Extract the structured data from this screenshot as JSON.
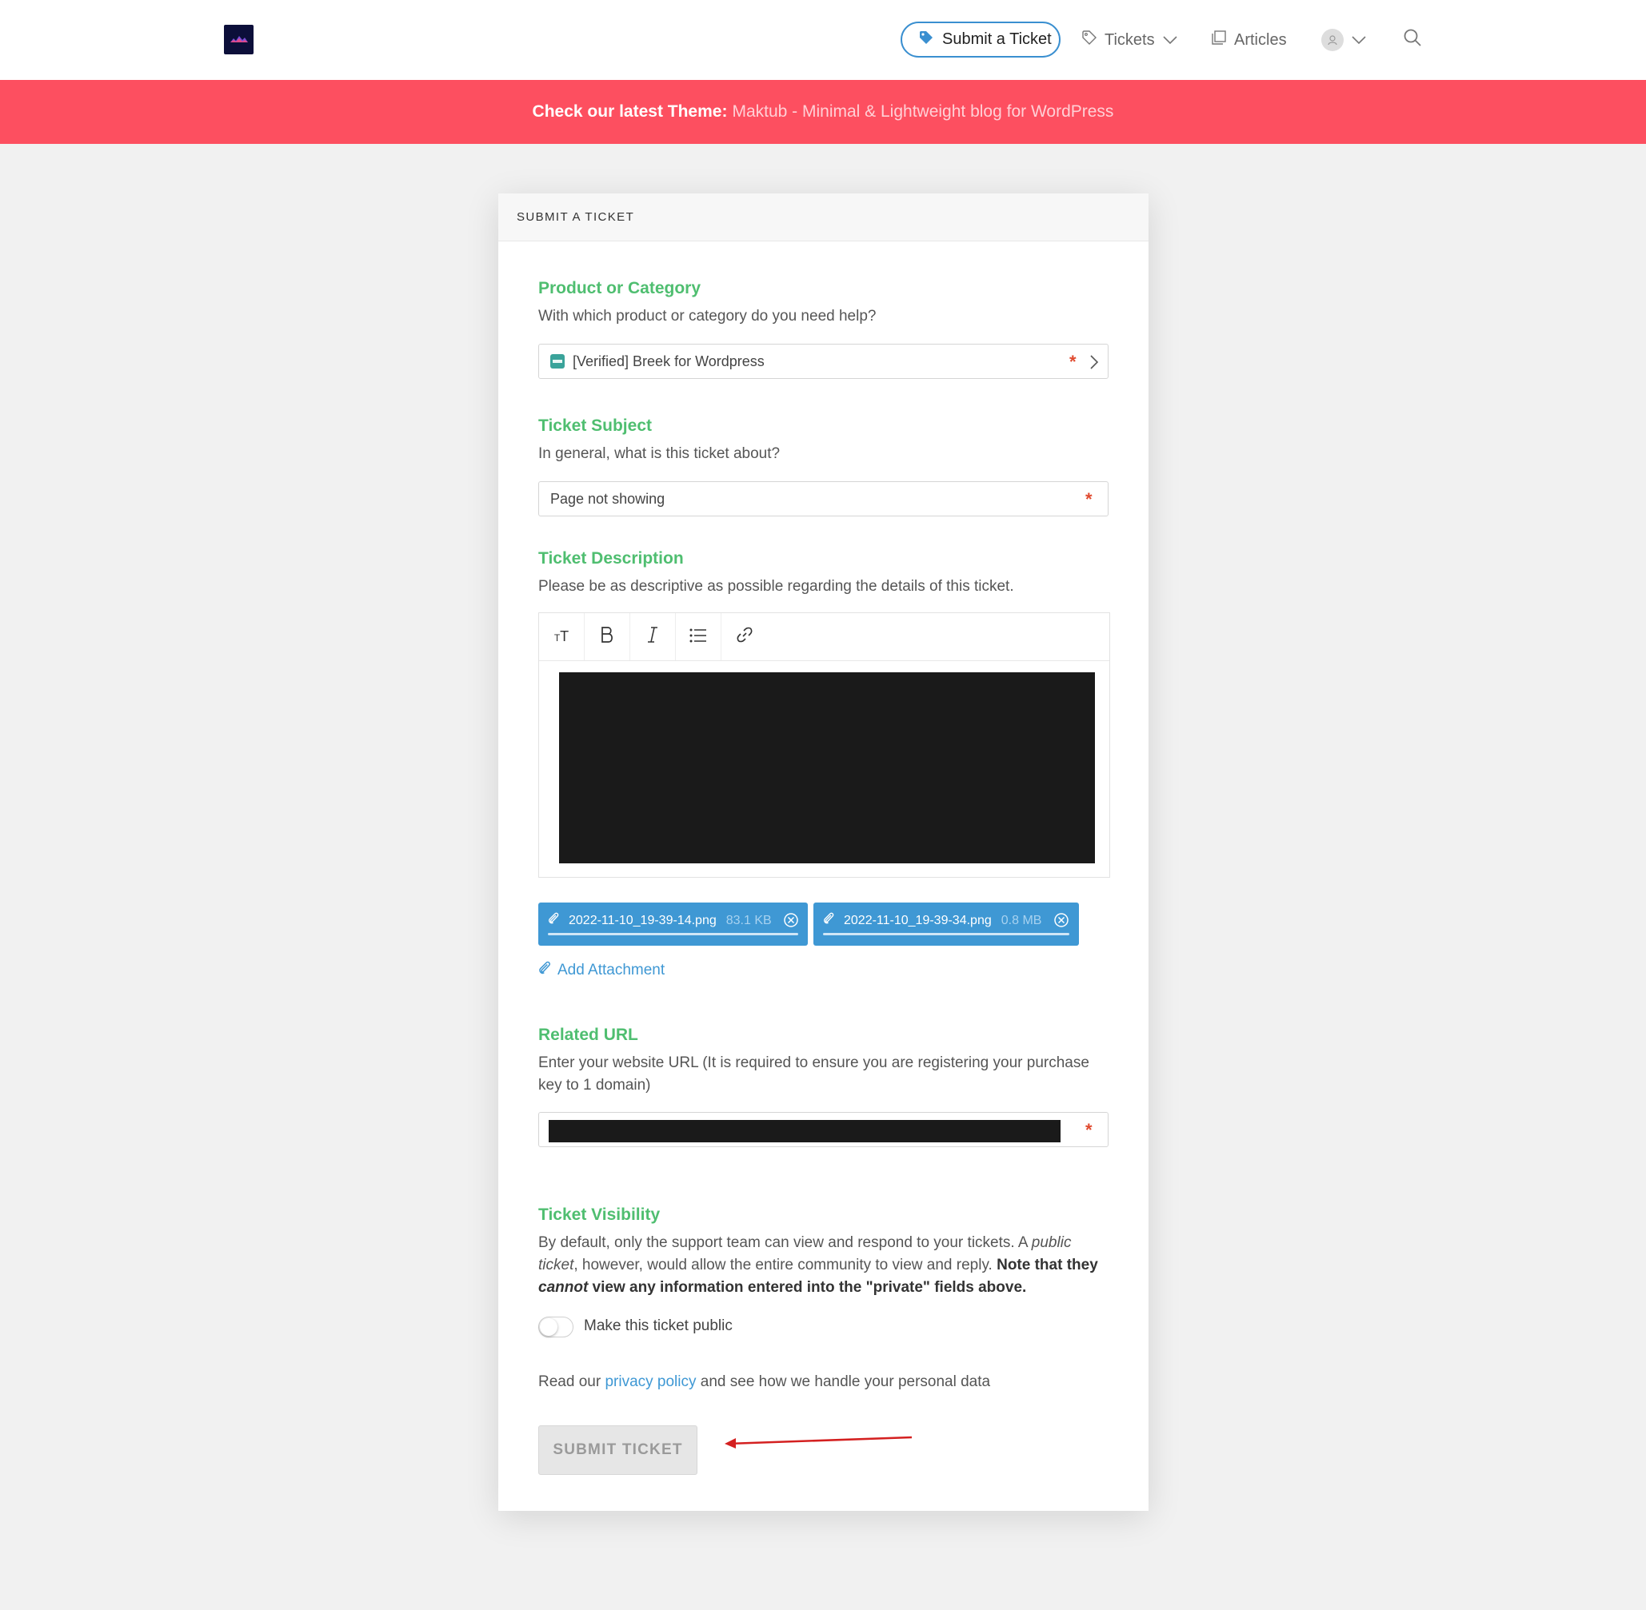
{
  "header": {
    "logo_alt": "site-logo",
    "submit_label": "Submit a Ticket",
    "tickets_label": "Tickets",
    "articles_label": "Articles"
  },
  "banner": {
    "label": "Check our latest Theme:",
    "link": "Maktub - Minimal & Lightweight blog for WordPress"
  },
  "card": {
    "title": "SUBMIT A TICKET",
    "product": {
      "title": "Product or Category",
      "description": "With which product or category do you need help?",
      "value": "[Verified] Breek for Wordpress"
    },
    "subject": {
      "title": "Ticket Subject",
      "description": "In general, what is this ticket about?",
      "value": "Page not showing"
    },
    "description": {
      "title": "Ticket Description",
      "description": "Please be as descriptive as possible regarding the details of this ticket.",
      "toolbar": [
        "text-size-icon",
        "bold-icon",
        "italic-icon",
        "bullet-list-icon",
        "link-icon"
      ]
    },
    "attachments": [
      {
        "name": "2022-11-10_19-39-14.png",
        "size": "83.1 KB"
      },
      {
        "name": "2022-11-10_19-39-34.png",
        "size": "0.8 MB"
      }
    ],
    "add_attachment": "Add Attachment",
    "related_url": {
      "title": "Related URL",
      "description": "Enter your website URL (It is required to ensure you are registering your purchase key to 1 domain)"
    },
    "visibility": {
      "title": "Ticket Visibility",
      "text_1": "By default, only the support team can view and respond to your tickets. A ",
      "text_public": "public ticket",
      "text_2": ", however, would allow the entire community to view and reply. ",
      "text_bold_1": "Note that they ",
      "text_cannot": "cannot",
      "text_bold_2": " view any information entered into the \"private\" fields above.",
      "toggle_label": "Make this ticket public",
      "toggle_on": false
    },
    "privacy": {
      "prefix": "Read our ",
      "link": "privacy policy",
      "suffix": " and see how we handle your personal data"
    },
    "submit_label": "SUBMIT TICKET"
  },
  "colors": {
    "accent_green": "#4fbe70",
    "link_blue": "#3f98d4",
    "banner_red": "#fd4f60",
    "required_red": "#e04a2f"
  }
}
